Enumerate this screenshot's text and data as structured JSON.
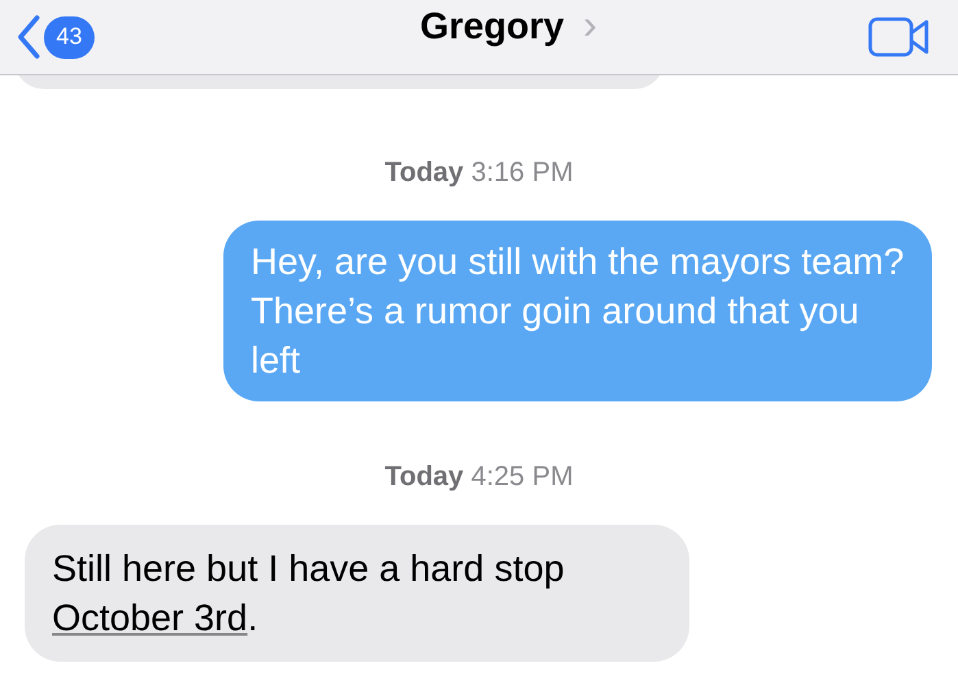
{
  "header": {
    "unread_count": "43",
    "contact_name": "Gregory",
    "chevron": "›"
  },
  "messages": [
    {
      "kind": "partial"
    },
    {
      "kind": "timestamp",
      "text": "**Today** 3:16 PM"
    },
    {
      "kind": "sent",
      "text": "Hey, are you still with the mayors team? There’s a rumor goin around that you left"
    },
    {
      "kind": "timestamp",
      "text": "**Today** 4:25 PM"
    },
    {
      "kind": "received",
      "text": "Still here but I have a hard stop ",
      "link": "October 3rd",
      "after": "."
    }
  ]
}
